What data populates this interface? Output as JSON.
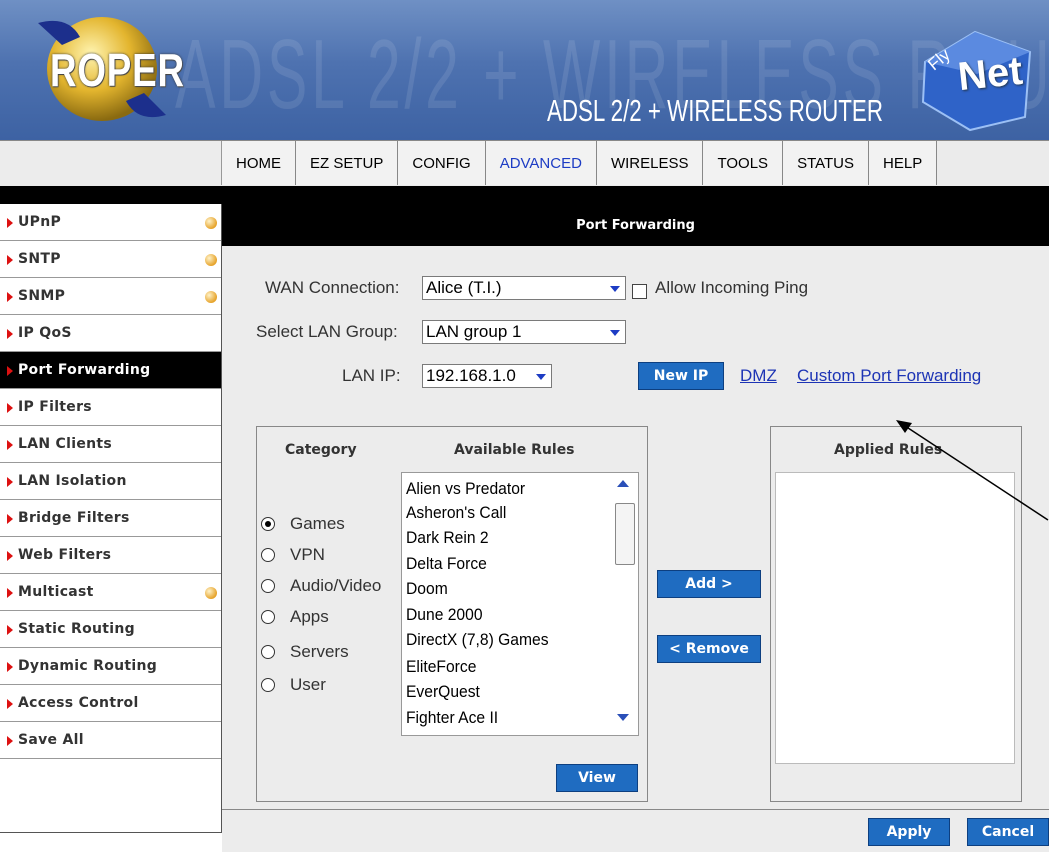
{
  "banner": {
    "logo": "ROPER",
    "ghost_text": "ADSL 2/2 + WIRELESS ROUTER",
    "product_title": "ADSL 2/2 + WIRELESS ROUTER",
    "brand_fly": "Fly",
    "brand_net": "Net"
  },
  "nav": {
    "tabs": [
      "HOME",
      "EZ SETUP",
      "CONFIG",
      "ADVANCED",
      "WIRELESS",
      "TOOLS",
      "STATUS",
      "HELP"
    ],
    "active": "ADVANCED"
  },
  "sidebar": {
    "items": [
      {
        "label": "UPnP",
        "dot": true
      },
      {
        "label": "SNTP",
        "dot": true
      },
      {
        "label": "SNMP",
        "dot": true
      },
      {
        "label": "IP QoS",
        "dot": false
      },
      {
        "label": "Port Forwarding",
        "dot": false,
        "active": true
      },
      {
        "label": "IP Filters",
        "dot": false
      },
      {
        "label": "LAN Clients",
        "dot": false
      },
      {
        "label": "LAN Isolation",
        "dot": false
      },
      {
        "label": "Bridge Filters",
        "dot": false
      },
      {
        "label": "Web Filters",
        "dot": false
      },
      {
        "label": "Multicast",
        "dot": true
      },
      {
        "label": "Static Routing",
        "dot": false
      },
      {
        "label": "Dynamic Routing",
        "dot": false
      },
      {
        "label": "Access Control",
        "dot": false
      },
      {
        "label": "Save All",
        "dot": false
      }
    ]
  },
  "main": {
    "section_title": "Port Forwarding",
    "wan_label": "WAN Connection:",
    "wan_value": "Alice (T.I.)",
    "allow_ping_label": "Allow Incoming Ping",
    "allow_ping_checked": false,
    "lan_group_label": "Select LAN Group:",
    "lan_group_value": "LAN group 1",
    "lan_ip_label": "LAN IP:",
    "lan_ip_value": "192.168.1.0",
    "new_ip_button": "New IP",
    "dmz_link": "DMZ",
    "custom_link": "Custom Port Forwarding",
    "category_header": "Category",
    "available_header": "Available Rules",
    "applied_header": "Applied Rules",
    "categories": [
      "Games",
      "VPN",
      "Audio/Video",
      "Apps",
      "Servers",
      "User"
    ],
    "selected_category": "Games",
    "available_rules": [
      "Alien vs Predator",
      "Asheron's Call",
      "Dark Rein 2",
      "Delta Force",
      "Doom",
      "Dune 2000",
      "DirectX (7,8) Games",
      "EliteForce",
      "EverQuest",
      "Fighter Ace II"
    ],
    "add_button": "Add >",
    "remove_button": "< Remove",
    "view_button": "View",
    "apply_button": "Apply",
    "cancel_button": "Cancel"
  },
  "colors": {
    "banner_blue": "#4e72b0",
    "button_blue": "#1f6cc1",
    "link_blue": "#1d34b5",
    "active_tab": "#1d3cc4",
    "sidebar_arrow": "#dd1111"
  }
}
